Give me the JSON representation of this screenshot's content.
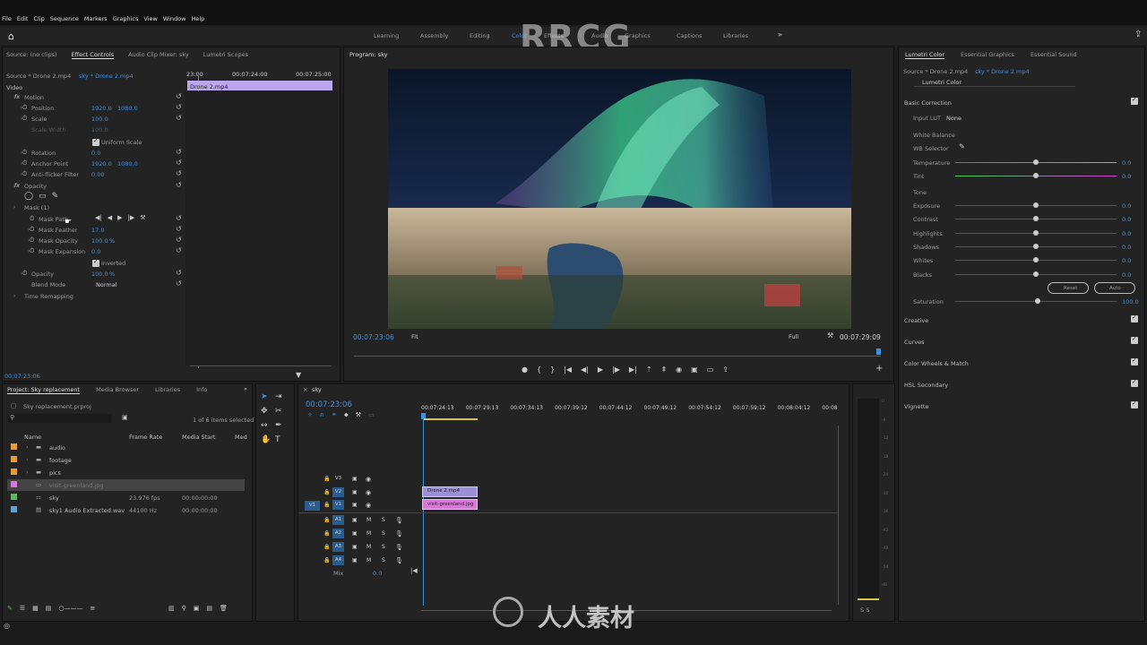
{
  "menu": [
    "File",
    "Edit",
    "Clip",
    "Sequence",
    "Markers",
    "Graphics",
    "View",
    "Window",
    "Help"
  ],
  "workspaces": [
    "Learning",
    "Assembly",
    "Editing",
    "Color",
    "Effects",
    "Audio",
    "Graphics",
    "Captions",
    "Libraries"
  ],
  "watermark": {
    "top": "RRCG",
    "bottom": "人人素材"
  },
  "effect_controls": {
    "tabs": [
      "Source: (no clips)",
      "Effect Controls",
      "Audio Clip Mixer: sky",
      "Lumetri Scopes"
    ],
    "clip_selector": {
      "master": "Source * Drone 2.mp4",
      "seq": "sky * Drone 2.mp4"
    },
    "ruler": {
      "t0": "23:00",
      "t1": "00:07:24:00",
      "t2": "00:07:25:00"
    },
    "clip_bar": "Drone 2.mp4",
    "section": "Video",
    "props": [
      {
        "name": "Motion",
        "v1": "",
        "v2": ""
      },
      {
        "name": "Position",
        "v1": "1920.0",
        "v2": "1080.0"
      },
      {
        "name": "Scale",
        "v1": "100.0",
        "v2": ""
      },
      {
        "name": "Scale Width",
        "v1": "100.0",
        "v2": ""
      },
      {
        "name": "Uniform Scale",
        "v1": "",
        "v2": ""
      },
      {
        "name": "Rotation",
        "v1": "0.0",
        "v2": ""
      },
      {
        "name": "Anchor Point",
        "v1": "1920.0",
        "v2": "1080.0"
      },
      {
        "name": "Anti-flicker Filter",
        "v1": "0.00",
        "v2": ""
      },
      {
        "name": "Opacity",
        "v1": "",
        "v2": ""
      },
      {
        "name": "Mask (1)",
        "v1": "",
        "v2": ""
      },
      {
        "name": "Mask Path",
        "v1": "",
        "v2": ""
      },
      {
        "name": "Mask Feather",
        "v1": "17.0",
        "v2": ""
      },
      {
        "name": "Mask Opacity",
        "v1": "100.0",
        "v2": "%"
      },
      {
        "name": "Mask Expansion",
        "v1": "0.0",
        "v2": ""
      },
      {
        "name": "Inverted",
        "v1": "",
        "v2": ""
      },
      {
        "name": "Opacity",
        "v1": "100.0",
        "v2": "%"
      },
      {
        "name": "Blend Mode",
        "v1": "Normal",
        "v2": ""
      },
      {
        "name": "Time Remapping",
        "v1": "",
        "v2": ""
      }
    ],
    "timecode": "00:07:23:06"
  },
  "program": {
    "title": "Program: sky",
    "timecode_left": "00:07:23:06",
    "fit": "Fit",
    "quality": "Full",
    "timecode_right": "00:07:29:09"
  },
  "lumetri": {
    "tabs": [
      "Lumetri Color",
      "Essential Graphics",
      "Essential Sound"
    ],
    "clip_selector": {
      "master": "Source * Drone 2.mp4",
      "seq": "sky * Drone 2.mp4"
    },
    "effect": "Lumetri Color",
    "basic": "Basic Correction",
    "input_lut_label": "Input LUT",
    "input_lut_value": "None",
    "white_balance": "White Balance",
    "wb_selector": "WB Selector",
    "sliders_wb": [
      {
        "label": "Temperature",
        "value": "0.0",
        "pos": 0.5
      },
      {
        "label": "Tint",
        "value": "0.0",
        "pos": 0.5
      }
    ],
    "tone": "Tone",
    "sliders_tone": [
      {
        "label": "Exposure",
        "value": "0.0",
        "pos": 0.5
      },
      {
        "label": "Contrast",
        "value": "0.0",
        "pos": 0.5
      },
      {
        "label": "Highlights",
        "value": "0.0",
        "pos": 0.5
      },
      {
        "label": "Shadows",
        "value": "0.0",
        "pos": 0.5
      },
      {
        "label": "Whites",
        "value": "0.0",
        "pos": 0.5
      },
      {
        "label": "Blacks",
        "value": "0.0",
        "pos": 0.5
      }
    ],
    "reset": "Reset",
    "auto": "Auto",
    "saturation": {
      "label": "Saturation",
      "value": "100.0"
    },
    "sections": [
      "Creative",
      "Curves",
      "Color Wheels & Match",
      "HSL Secondary",
      "Vignette"
    ]
  },
  "project": {
    "tabs": [
      "Project: Sky replacement",
      "Media Browser",
      "Libraries",
      "Info"
    ],
    "file": "Sky replacement.prproj",
    "count": "1 of 6 items selected",
    "columns": [
      "Name",
      "Frame Rate",
      "Media Start",
      "Med"
    ],
    "items": [
      {
        "name": "audio",
        "rate": "",
        "start": "",
        "color": "#e89a3c",
        "kind": "folder"
      },
      {
        "name": "footage",
        "rate": "",
        "start": "",
        "color": "#e89a3c",
        "kind": "folder"
      },
      {
        "name": "pics",
        "rate": "",
        "start": "",
        "color": "#e89a3c",
        "kind": "folder"
      },
      {
        "name": "visit-greenland.jpg",
        "rate": "",
        "start": "",
        "color": "#d77ad7",
        "kind": "image"
      },
      {
        "name": "sky",
        "rate": "23.976 fps",
        "start": "00:00:00:00",
        "color": "#5cb85c",
        "kind": "seq"
      },
      {
        "name": "sky1 Audio Extracted.wav",
        "rate": "44100 Hz",
        "start": "00:00:00:00",
        "color": "#5ba3d6",
        "kind": "audio"
      }
    ]
  },
  "timeline": {
    "tab": "sky",
    "timecode": "00:07:23:06",
    "ruler": [
      "00:07:24:13",
      "00:07:29:13",
      "00:07:34:13",
      "00:07:39:12",
      "00:07:44:12",
      "00:07:49:12",
      "00:07:54:12",
      "00:07:59:12",
      "00:08:04:12",
      "00:08"
    ],
    "video_tracks": [
      "V3",
      "V2",
      "V1"
    ],
    "audio_tracks": [
      "A1",
      "A2",
      "A3",
      "A4"
    ],
    "src_patch": "V1",
    "mix": {
      "label": "Mix",
      "value": "0.0"
    },
    "clips": {
      "v2": "Drone 2.mp4",
      "v1": "visit-greenland.jpg"
    }
  },
  "meter": {
    "labels": [
      "0",
      "-6",
      "-12",
      "-18",
      "-24",
      "-30",
      "-36",
      "-42",
      "-48",
      "-54",
      "dB"
    ],
    "bottom": "S S"
  },
  "colors": {
    "accent": "#3d8fe0",
    "clip_v2": "#9b8fd6",
    "clip_v1": "#d77ad7",
    "bg": "#1d1d1d"
  }
}
